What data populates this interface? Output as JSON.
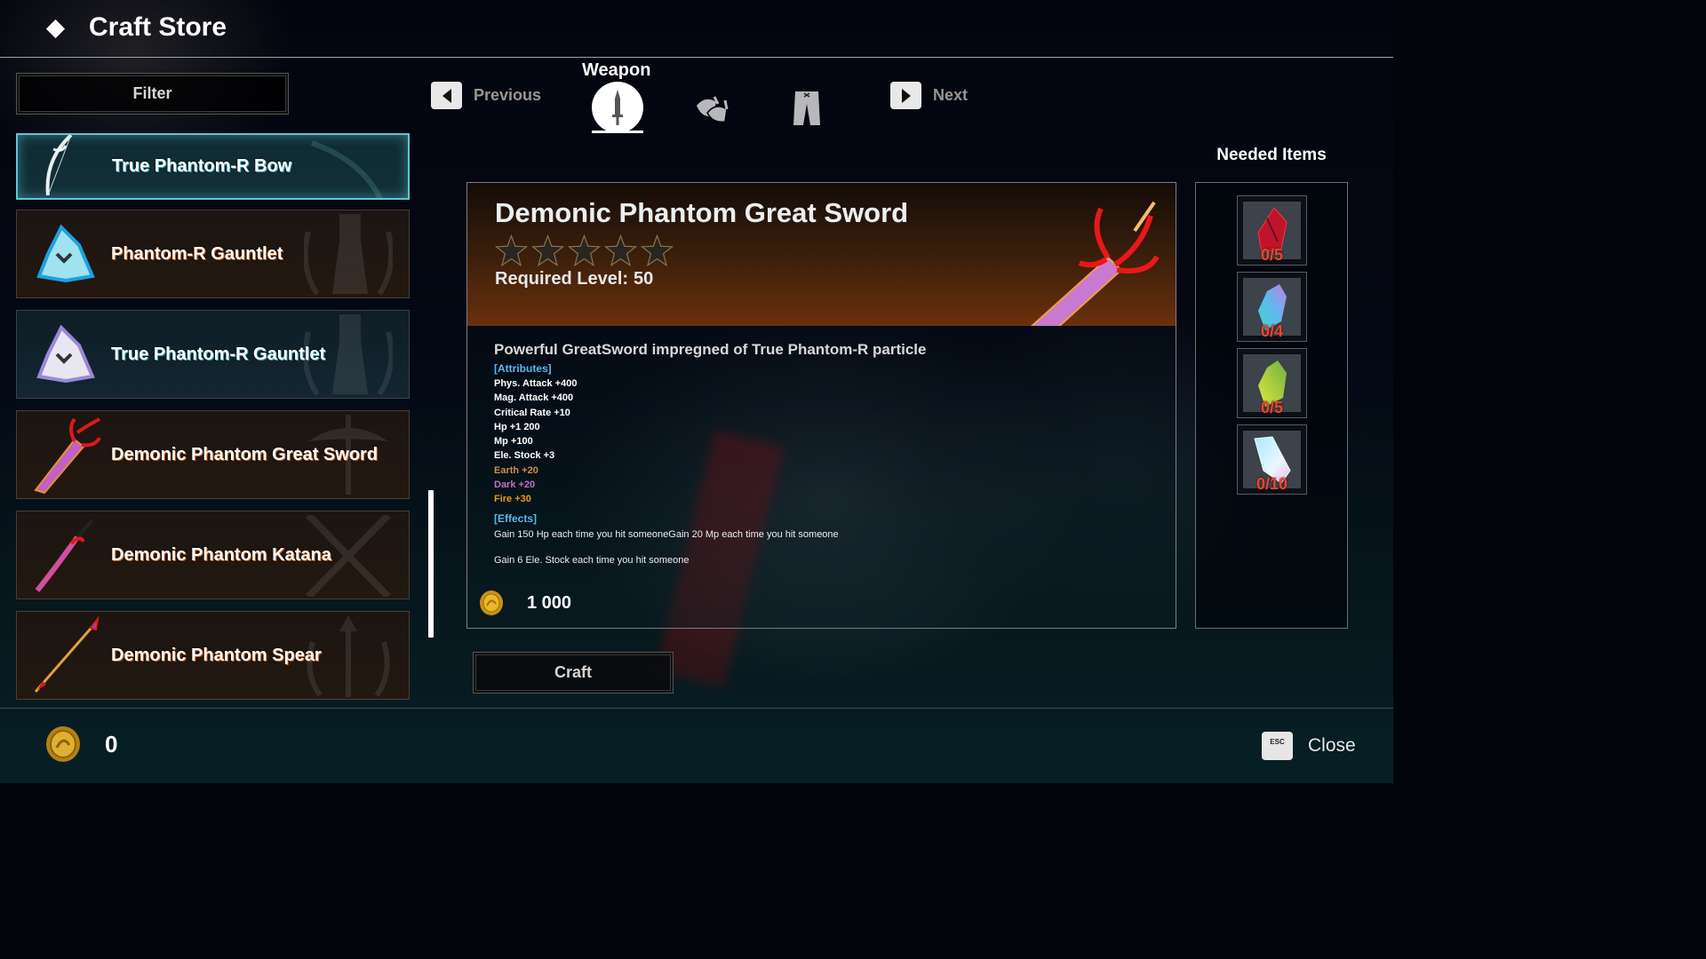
{
  "header": {
    "title": "Craft Store"
  },
  "filter": {
    "label": "Filter"
  },
  "category_nav": {
    "previous_label": "Previous",
    "next_label": "Next",
    "current_category": "Weapon",
    "tabs": [
      {
        "name": "Weapon",
        "icon": "sword-icon",
        "active": true
      },
      {
        "name": "Armor",
        "icon": "shoulder-armor-icon",
        "active": false
      },
      {
        "name": "Pants",
        "icon": "pants-icon",
        "active": false
      }
    ]
  },
  "item_list": [
    {
      "name": "True Phantom-R Bow",
      "icon": "bow-icon",
      "style": "selected"
    },
    {
      "name": "Phantom-R Gauntlet",
      "icon": "gauntlet-icon",
      "style": "brown"
    },
    {
      "name": "True Phantom-R Gauntlet",
      "icon": "gauntlet-icon",
      "style": "blue"
    },
    {
      "name": "Demonic Phantom Great Sword",
      "icon": "great-sword-icon",
      "style": "brown"
    },
    {
      "name": "Demonic Phantom Katana",
      "icon": "katana-icon",
      "style": "brown"
    },
    {
      "name": "Demonic Phantom Spear",
      "icon": "spear-icon",
      "style": "brown"
    }
  ],
  "detail": {
    "title": "Demonic Phantom Great Sword",
    "stars_total": 5,
    "stars_filled": 0,
    "required_level_label": "Required Level:",
    "required_level": "50",
    "description": "Powerful GreatSword impregned of True Phantom-R particle",
    "attributes_header": "[Attributes]",
    "attributes": [
      {
        "text": "Phys. Attack +400",
        "color": "#ffffff"
      },
      {
        "text": "Mag. Attack +400",
        "color": "#ffffff"
      },
      {
        "text": "Critical Rate +10",
        "color": "#ffffff"
      },
      {
        "text": "Hp +1 200",
        "color": "#ffffff"
      },
      {
        "text": "Mp +100",
        "color": "#ffffff"
      },
      {
        "text": "Ele. Stock +3",
        "color": "#ffffff"
      },
      {
        "text": "Earth +20",
        "color": "#c8904a"
      },
      {
        "text": "Dark +20",
        "color": "#c070c8"
      },
      {
        "text": "Fire +30",
        "color": "#f0961c"
      }
    ],
    "effects_header": "[Effects]",
    "effects": [
      "Gain 150 Hp each time you hit someoneGain 20 Mp each time you hit someone",
      "Gain 6 Ele. Stock each time you hit someone"
    ],
    "price": "1 000"
  },
  "needed_items": {
    "title": "Needed Items",
    "items": [
      {
        "material": "red-crystal",
        "count": "0/5",
        "color": "#c0142a"
      },
      {
        "material": "rainbow-crystal",
        "count": "0/4",
        "color": "#5ad0d8"
      },
      {
        "material": "green-crystal",
        "count": "0/5",
        "color": "#a8d040"
      },
      {
        "material": "clear-crystal",
        "count": "0/10",
        "color": "#c8ecf8"
      }
    ]
  },
  "craft_button": {
    "label": "Craft"
  },
  "footer": {
    "gold": "0",
    "close_key": "ESC",
    "close_label": "Close"
  }
}
